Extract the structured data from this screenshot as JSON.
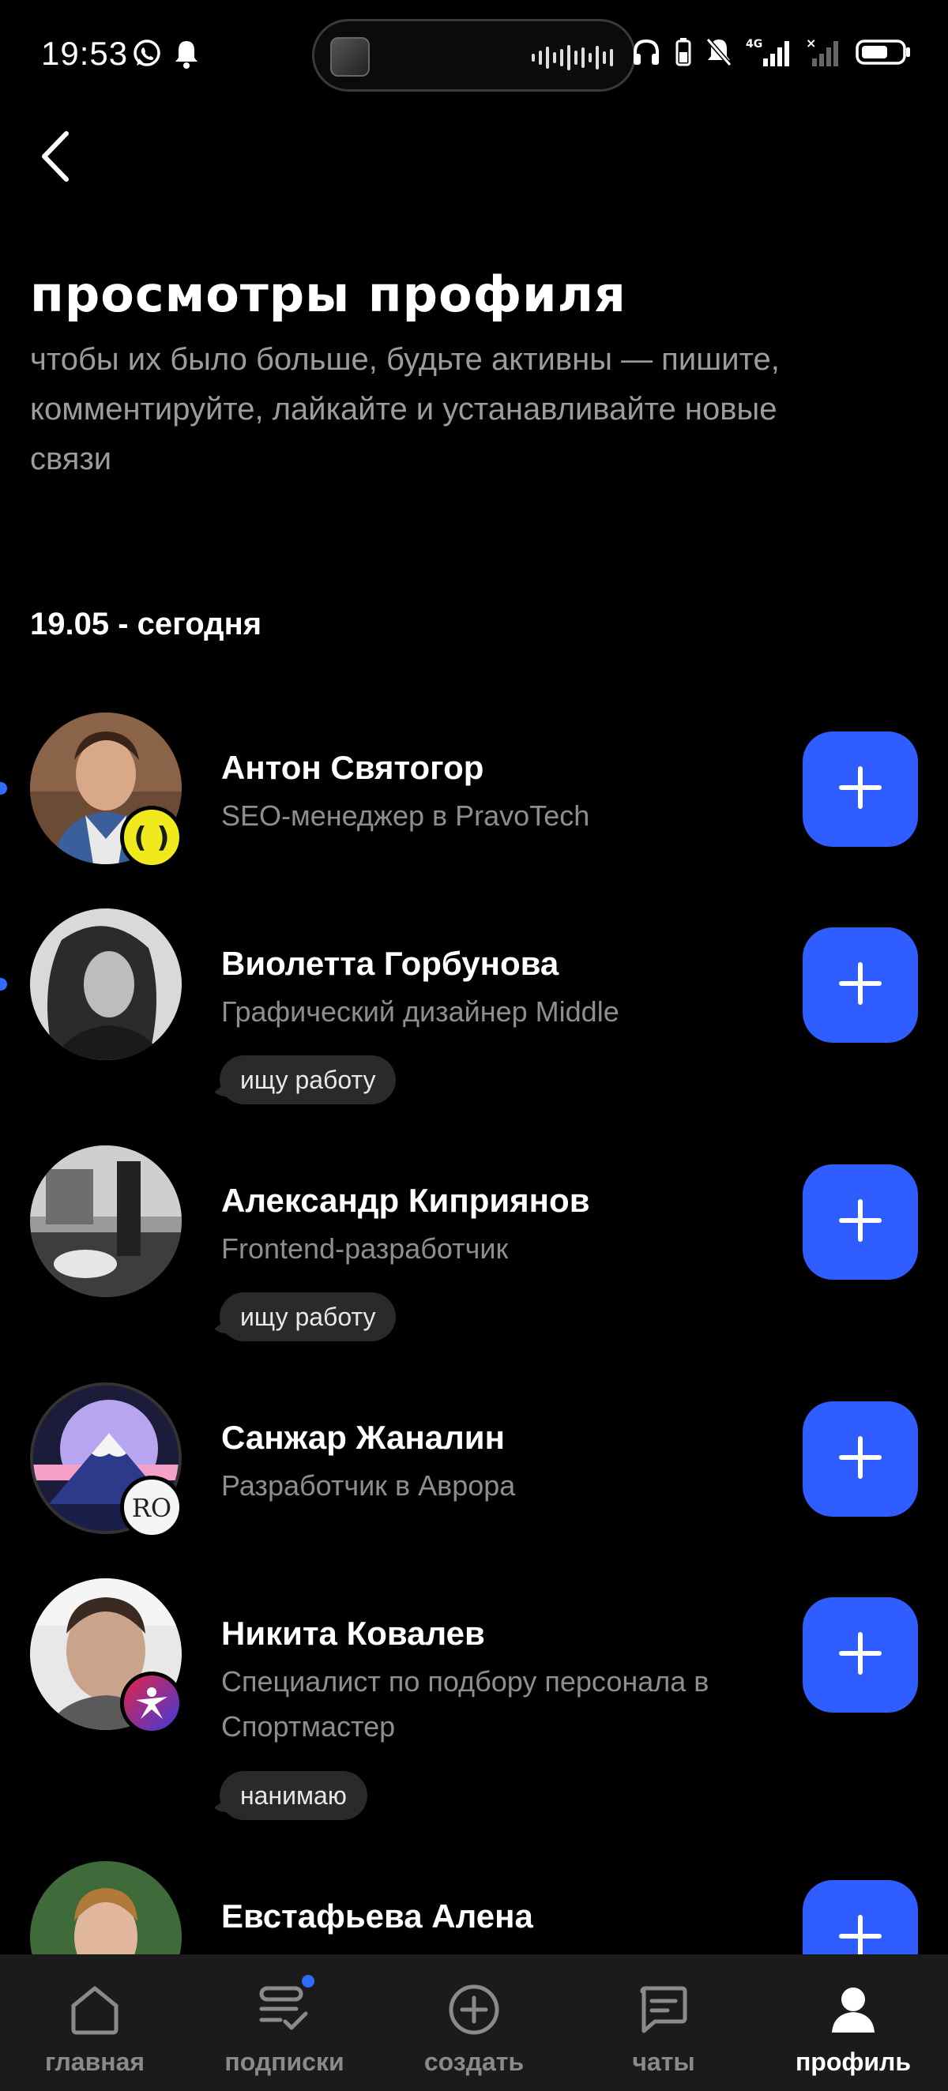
{
  "status_bar": {
    "time": "19:53",
    "network": "4G"
  },
  "header": {
    "back_icon": "chevron-left-icon",
    "title": "просмотры профиля",
    "subtitle": "чтобы их было больше, будьте активны — пишите, комментируйте, лайкайте и устанавливайте новые связи"
  },
  "date_range": "19.05 - сегодня",
  "people": [
    {
      "name": "Антон Святогор",
      "role": "SEO-менеджер в PravoTech",
      "tag": "",
      "unread": true
    },
    {
      "name": "Виолетта Горбунова",
      "role": "Графический дизайнер Middle",
      "tag": "ищу работу",
      "unread": true
    },
    {
      "name": "Александр Киприянов",
      "role": "Frontend-разработчик",
      "tag": "ищу работу",
      "unread": false
    },
    {
      "name": "Санжар Жаналин",
      "role": "Разработчик в Аврора",
      "tag": "",
      "badge_text": "RO",
      "unread": false
    },
    {
      "name": "Никита Ковалев",
      "role": "Специалист по подбору персонала в Спортмастер",
      "tag": "нанимаю",
      "unread": false
    },
    {
      "name": "Евстафьева Алена",
      "role": "",
      "tag": "",
      "unread": false
    }
  ],
  "colors": {
    "accent": "#2f5dff",
    "badge_yellow": "#f0ea1c",
    "background": "#000000",
    "nav_background": "#1b1b1b"
  },
  "bottom_nav": {
    "items": [
      {
        "label": "главная",
        "icon": "home-icon"
      },
      {
        "label": "подписки",
        "icon": "subscriptions-icon"
      },
      {
        "label": "создать",
        "icon": "plus-square-icon"
      },
      {
        "label": "чаты",
        "icon": "chat-icon"
      },
      {
        "label": "профиль",
        "icon": "person-icon"
      }
    ],
    "active": "профиль"
  }
}
